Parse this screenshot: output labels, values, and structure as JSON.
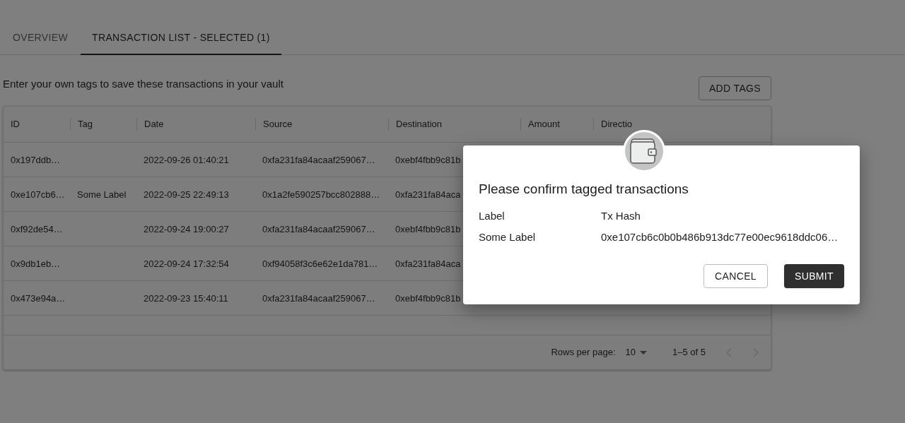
{
  "tabs": [
    {
      "label": "OVERVIEW",
      "selected": false
    },
    {
      "label": "TRANSACTION LIST - SELECTED (1)",
      "selected": true
    }
  ],
  "intro": "Enter your own tags to save these transactions in your vault",
  "add_tags_button": "ADD TAGS",
  "table": {
    "columns": [
      "ID",
      "Tag",
      "Date",
      "Source",
      "Destination",
      "Amount",
      "Directio"
    ],
    "rows": [
      [
        "0x197ddb…",
        "",
        "2022-09-26 01:40:21",
        "0xfa231fa84acaaf259067…",
        "0xebf4fbb9c81b"
      ],
      [
        "0xe107cb6…",
        "Some Label",
        "2022-09-25 22:49:13",
        "0x1a2fe590257bcc802888…",
        "0xfa231fa84aca"
      ],
      [
        "0xf92de54…",
        "",
        "2022-09-24 19:00:27",
        "0xfa231fa84acaaf259067…",
        "0xebf4fbb9c81b"
      ],
      [
        "0x9db1eb…",
        "",
        "2022-09-24 17:32:54",
        "0xf94058f3c6e62e1da781…",
        "0xfa231fa84aca"
      ],
      [
        "0x473e94a…",
        "",
        "2022-09-23 15:40:11",
        "0xfa231fa84acaaf259067…",
        "0xebf4fbb9c81b"
      ]
    ]
  },
  "pagination": {
    "rows_per_page_label": "Rows per page:",
    "rows_per_page": "10",
    "range": "1–5 of 5",
    "previous_disabled": true,
    "next_disabled": true
  },
  "dialog": {
    "title": "Please confirm tagged transactions",
    "columns": [
      "Label",
      "Tx Hash"
    ],
    "rows": [
      [
        "Some Label",
        "0xe107cb6c0b0b486b913dc77e00ec9618ddc06…"
      ]
    ],
    "buttons": [
      {
        "label": "CANCEL",
        "kind": "outlined"
      },
      {
        "label": "SUBMIT",
        "kind": "filled"
      }
    ]
  }
}
